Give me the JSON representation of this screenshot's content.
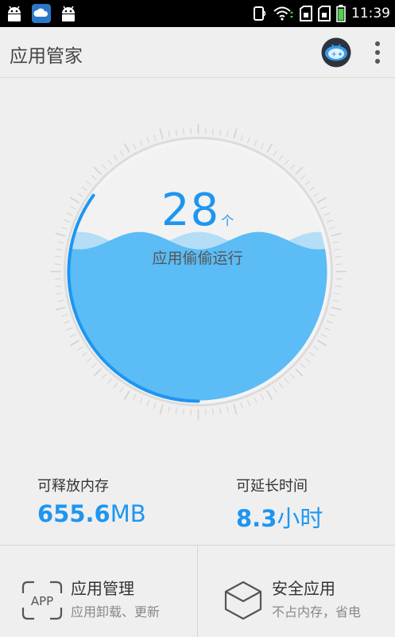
{
  "status_bar": {
    "time": "11:39",
    "left_icons": [
      "android-icon",
      "cloud-app-icon",
      "android-icon"
    ],
    "right_icons": [
      "nfc-icon",
      "wifi-icon",
      "sim-icon",
      "sim-icon",
      "battery-icon"
    ]
  },
  "app_bar": {
    "title": "应用管家",
    "actions": [
      "robot-assistant-icon",
      "more-vert-icon"
    ]
  },
  "gauge": {
    "count": "28",
    "unit": "个",
    "label": "应用偷偷运行",
    "fill_fraction": 0.62,
    "progress_fraction": 0.35
  },
  "stats": {
    "free_memory": {
      "label": "可释放内存",
      "value": "655.6",
      "unit": "MB"
    },
    "extend_time": {
      "label": "可延长时间",
      "value": "8.3",
      "unit": "小时"
    }
  },
  "cards": {
    "app_manage": {
      "title": "应用管理",
      "subtitle": "应用卸载、更新",
      "icon_text": "APP"
    },
    "secure_apps": {
      "title": "安全应用",
      "subtitle": "不占内存，省电"
    }
  },
  "colors": {
    "accent": "#1e96f0",
    "water": "#5bbcf6",
    "water_light": "#a9d9f7",
    "background": "#efefef"
  }
}
